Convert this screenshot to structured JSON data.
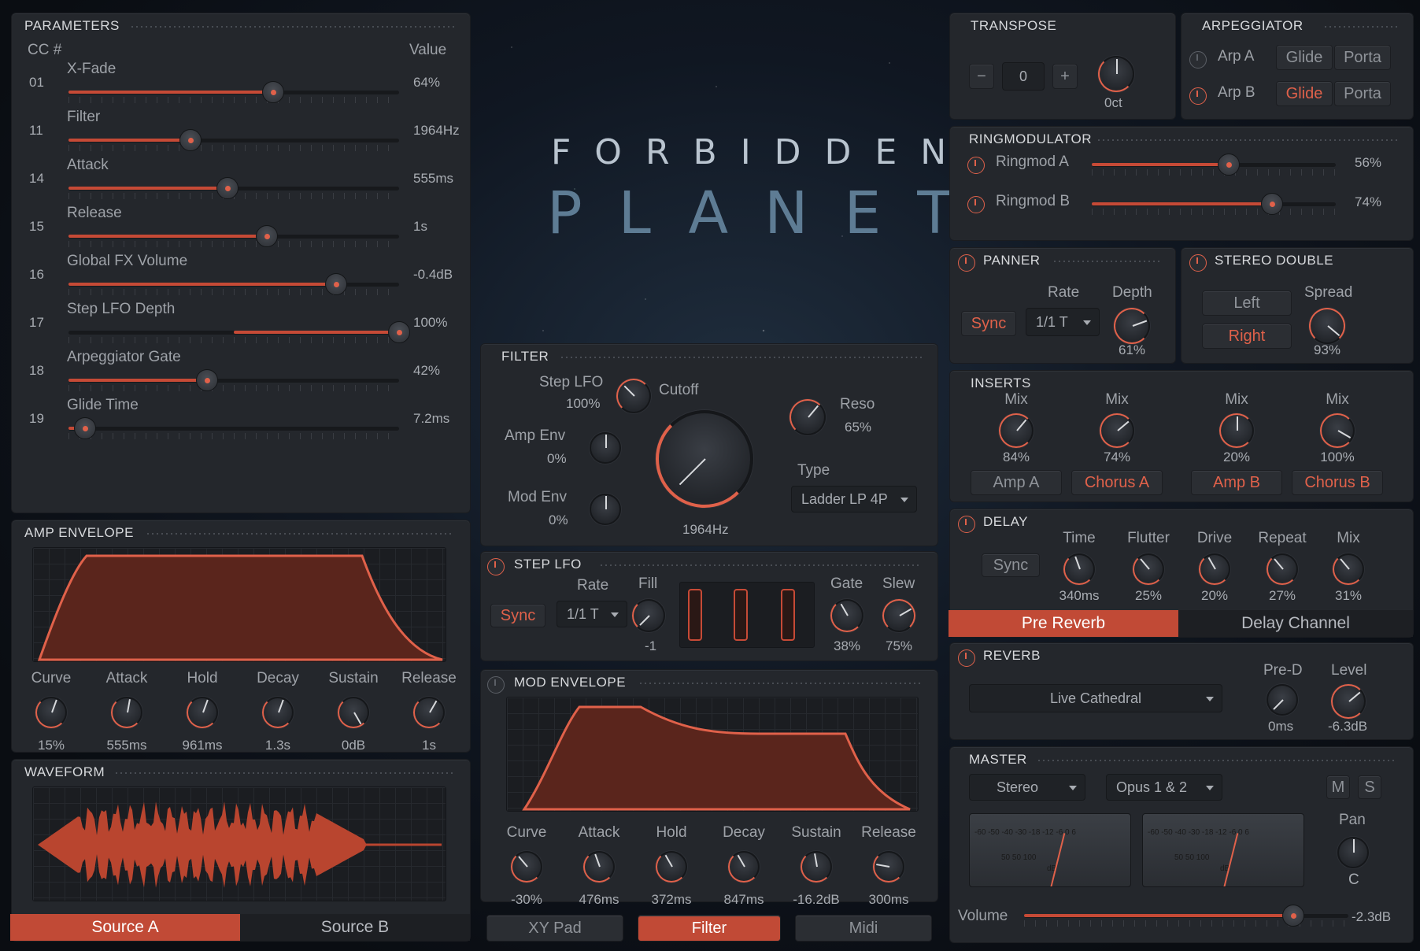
{
  "colors": {
    "accent": "#c64a36",
    "panel": "#24272c",
    "background": "#0f1115"
  },
  "logo": {
    "line1": "FORBIDDEN",
    "line2": "PLANET"
  },
  "parameters": {
    "title": "PARAMETERS",
    "cc_header": "CC #",
    "value_header": "Value",
    "rows": [
      {
        "cc": "01",
        "name": "X-Fade",
        "value": "64%",
        "level": 0.62
      },
      {
        "cc": "11",
        "name": "Filter",
        "value": "1964Hz",
        "level": 0.37
      },
      {
        "cc": "14",
        "name": "Attack",
        "value": "555ms",
        "level": 0.48
      },
      {
        "cc": "15",
        "name": "Release",
        "value": "1s",
        "level": 0.6
      },
      {
        "cc": "16",
        "name": "Global FX Volume",
        "value": "-0.4dB",
        "level": 0.81
      },
      {
        "cc": "17",
        "name": "Step LFO Depth",
        "value": "100%",
        "level": 1.0,
        "bipolar": true
      },
      {
        "cc": "18",
        "name": "Arpeggiator Gate",
        "value": "42%",
        "level": 0.42
      },
      {
        "cc": "19",
        "name": "Glide Time",
        "value": "7.2ms",
        "level": 0.05
      }
    ]
  },
  "amp_envelope": {
    "title": "AMP ENVELOPE",
    "controls": [
      {
        "label": "Curve",
        "value": "15%"
      },
      {
        "label": "Attack",
        "value": "555ms"
      },
      {
        "label": "Hold",
        "value": "961ms"
      },
      {
        "label": "Decay",
        "value": "1.3s"
      },
      {
        "label": "Sustain",
        "value": "0dB"
      },
      {
        "label": "Release",
        "value": "1s"
      }
    ]
  },
  "waveform": {
    "title": "WAVEFORM",
    "tabs": [
      "Source A",
      "Source B"
    ],
    "active_tab": "Source A"
  },
  "filter": {
    "title": "FILTER",
    "step_lfo_label": "Step LFO",
    "step_lfo_value": "100%",
    "amp_env_label": "Amp Env",
    "amp_env_value": "0%",
    "mod_env_label": "Mod Env",
    "mod_env_value": "0%",
    "cutoff_label": "Cutoff",
    "cutoff_value": "1964Hz",
    "reso_label": "Reso",
    "reso_value": "65%",
    "type_label": "Type",
    "type_value": "Ladder LP 4P"
  },
  "step_lfo": {
    "title": "STEP LFO",
    "sync_label": "Sync",
    "rate_label": "Rate",
    "rate_value": "1/1 T",
    "fill_label": "Fill",
    "fill_value": "-1",
    "gate_label": "Gate",
    "gate_value": "38%",
    "slew_label": "Slew",
    "slew_value": "75%"
  },
  "mod_envelope": {
    "title": "MOD ENVELOPE",
    "controls": [
      {
        "label": "Curve",
        "value": "-30%"
      },
      {
        "label": "Attack",
        "value": "476ms"
      },
      {
        "label": "Hold",
        "value": "372ms"
      },
      {
        "label": "Decay",
        "value": "847ms"
      },
      {
        "label": "Sustain",
        "value": "-16.2dB"
      },
      {
        "label": "Release",
        "value": "300ms"
      }
    ]
  },
  "center_tabs": {
    "items": [
      "XY Pad",
      "Filter",
      "Midi"
    ],
    "active": "Filter"
  },
  "transpose": {
    "title": "TRANSPOSE",
    "minus": "−",
    "value": "0",
    "plus": "+",
    "oct_label": "0ct"
  },
  "arpeggiator": {
    "title": "ARPEGGIATOR",
    "rows": [
      {
        "label": "Arp A",
        "glide": "Glide",
        "porta": "Porta",
        "on": false,
        "glide_on": false
      },
      {
        "label": "Arp B",
        "glide": "Glide",
        "porta": "Porta",
        "on": true,
        "glide_on": true
      }
    ]
  },
  "ringmod": {
    "title": "RINGMODULATOR",
    "rows": [
      {
        "label": "Ringmod A",
        "value": "56%",
        "level": 0.56
      },
      {
        "label": "Ringmod B",
        "value": "74%",
        "level": 0.74
      }
    ]
  },
  "panner": {
    "title": "PANNER",
    "sync_label": "Sync",
    "rate_label": "Rate",
    "rate_value": "1/1 T",
    "depth_label": "Depth",
    "depth_value": "61%"
  },
  "stereo_double": {
    "title": "STEREO DOUBLE",
    "left": "Left",
    "right": "Right",
    "spread_label": "Spread",
    "spread_value": "93%"
  },
  "inserts": {
    "title": "INSERTS",
    "items": [
      {
        "mix_label": "Mix",
        "mix_value": "84%",
        "button": "Amp A",
        "on": false
      },
      {
        "mix_label": "Mix",
        "mix_value": "74%",
        "button": "Chorus A",
        "on": true
      },
      {
        "mix_label": "Mix",
        "mix_value": "20%",
        "button": "Amp B",
        "on": true
      },
      {
        "mix_label": "Mix",
        "mix_value": "100%",
        "button": "Chorus B",
        "on": true
      }
    ]
  },
  "delay": {
    "title": "DELAY",
    "sync_label": "Sync",
    "controls": [
      {
        "label": "Time",
        "value": "340ms"
      },
      {
        "label": "Flutter",
        "value": "25%"
      },
      {
        "label": "Drive",
        "value": "20%"
      },
      {
        "label": "Repeat",
        "value": "27%"
      },
      {
        "label": "Mix",
        "value": "31%"
      }
    ],
    "tabs": [
      "Pre Reverb",
      "Delay Channel"
    ],
    "active_tab": "Pre Reverb"
  },
  "reverb": {
    "title": "REVERB",
    "preset": "Live Cathedral",
    "pred_label": "Pre-D",
    "pred_value": "0ms",
    "level_label": "Level",
    "level_value": "-6.3dB"
  },
  "master": {
    "title": "MASTER",
    "mode": "Stereo",
    "output": "Opus 1 & 2",
    "mute": "M",
    "solo": "S",
    "pan_label": "Pan",
    "pan_value": "C",
    "volume_label": "Volume",
    "volume_value": "-2.3dB",
    "volume_level": 0.83,
    "meter_top": "-60 -50 -40 -30   -18 -12 -6 0 6",
    "meter_mid": "50      50      100",
    "meter_unit": "dB"
  }
}
